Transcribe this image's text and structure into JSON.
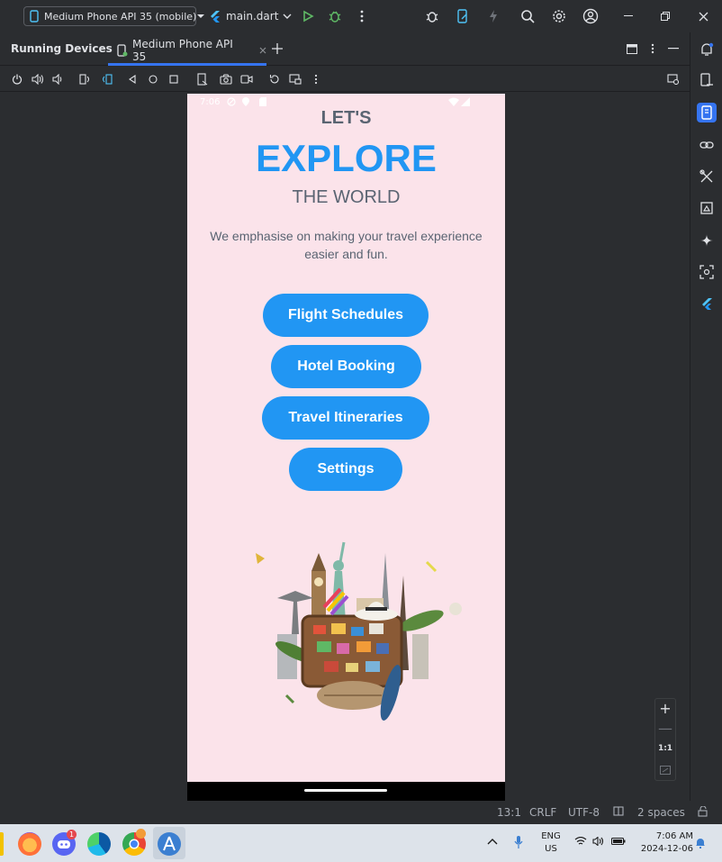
{
  "toolbar": {
    "device_select": "Medium Phone API 35 (mobile)",
    "run_config": "main.dart"
  },
  "tabs": {
    "running_devices": "Running Devices",
    "device_tab": "Medium Phone API 35"
  },
  "phone": {
    "status_time": "7:06",
    "lets": "LET'S",
    "explore": "EXPLORE",
    "world": "THE WORLD",
    "tagline": "We emphasise on making your travel experience easier and fun.",
    "buttons": [
      "Flight Schedules",
      "Hotel Booking",
      "Travel Itineraries",
      "Settings"
    ]
  },
  "zoom": {
    "in": "+",
    "out": "—",
    "one_to_one": "1:1"
  },
  "status_bar": {
    "position": "13:1",
    "line_sep": "CRLF",
    "encoding": "UTF-8",
    "indent": "2 spaces"
  },
  "taskbar": {
    "lang_1": "ENG",
    "lang_2": "US",
    "time": "7:06 AM",
    "date": "2024-12-06",
    "discord_badge": "1"
  },
  "colors": {
    "accent": "#2196f3",
    "phone_bg": "#fbe3ea",
    "ide_bg": "#2b2d30",
    "tab_highlight": "#3574f0"
  }
}
